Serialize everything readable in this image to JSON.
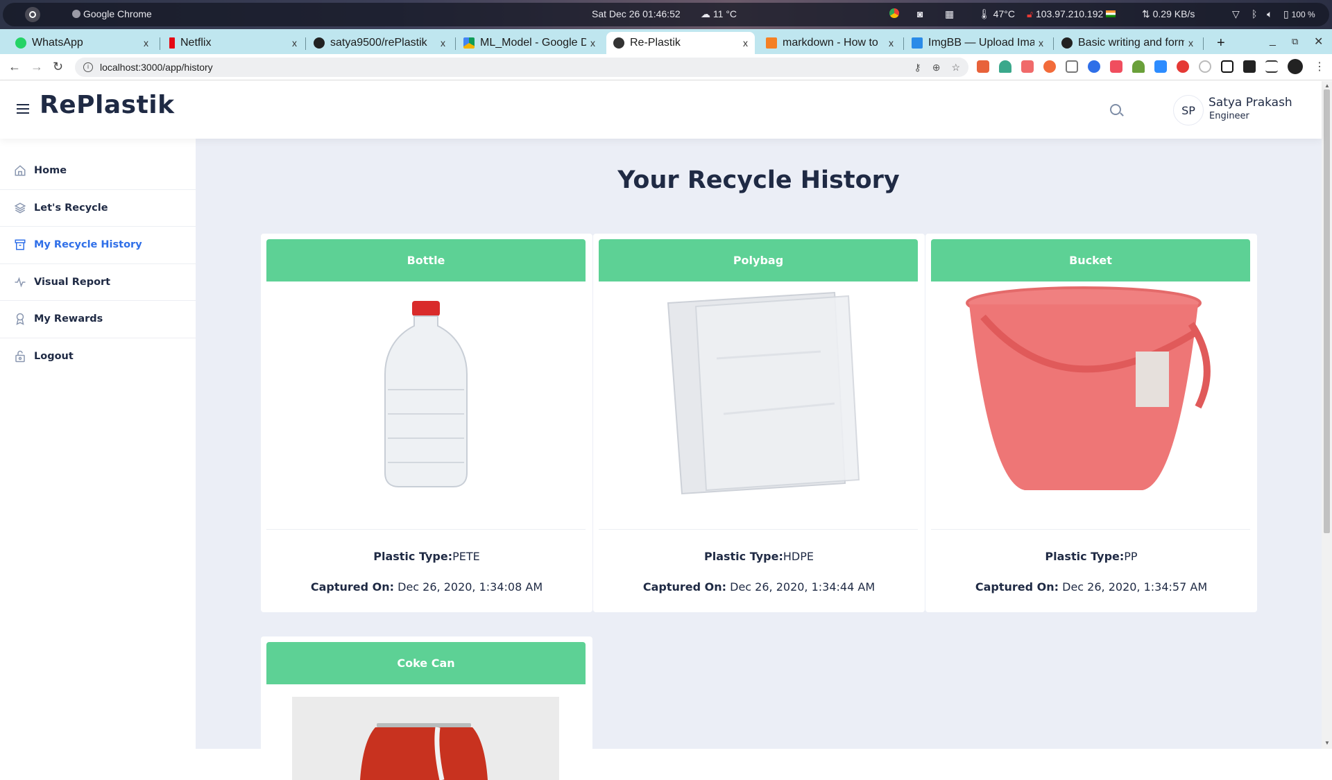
{
  "os_bar": {
    "app_name": "Google Chrome",
    "datetime": "Sat Dec 26  01:46:52",
    "weather": "11 °C",
    "cpu_temp": "47°C",
    "ip": "103.97.210.192",
    "net_speed": "0.29 KB/s",
    "battery": "100 %"
  },
  "tabs": [
    {
      "title": "WhatsApp",
      "icon": "whatsapp-icon",
      "color": "#25d366",
      "active": false
    },
    {
      "title": "Netflix",
      "icon": "netflix-icon",
      "color": "#e50914",
      "active": false
    },
    {
      "title": "satya9500/rePlastik",
      "icon": "github-icon",
      "color": "#222222",
      "active": false
    },
    {
      "title": "ML_Model - Google Drive",
      "icon": "google-drive-icon",
      "color": "#f4b400",
      "active": false
    },
    {
      "title": "Re-Plastik",
      "icon": "angular-icon",
      "color": "#333333",
      "active": true
    },
    {
      "title": "markdown - How to",
      "icon": "stackoverflow-icon",
      "color": "#f48024",
      "active": false
    },
    {
      "title": "ImgBB — Upload Image",
      "icon": "imgbb-icon",
      "color": "#2a8be8",
      "active": false
    },
    {
      "title": "Basic writing and formatting",
      "icon": "github-icon",
      "color": "#222222",
      "active": false
    }
  ],
  "tab_close_glyph": "x",
  "new_tab_glyph": "+",
  "address": {
    "url": "localhost:3000/app/history"
  },
  "app": {
    "brand": "RePlastik",
    "user": {
      "initials": "SP",
      "name": "Satya Prakash",
      "role": "Engineer"
    }
  },
  "sidebar": {
    "items": [
      {
        "label": "Home",
        "icon": "home-icon",
        "active": false
      },
      {
        "label": "Let's Recycle",
        "icon": "layers-icon",
        "active": false
      },
      {
        "label": "My Recycle History",
        "icon": "archive-icon",
        "active": true
      },
      {
        "label": "Visual Report",
        "icon": "activity-icon",
        "active": false
      },
      {
        "label": "My Rewards",
        "icon": "award-icon",
        "active": false
      },
      {
        "label": "Logout",
        "icon": "lock-icon",
        "active": false
      }
    ]
  },
  "main": {
    "title": "Your Recycle History",
    "type_label": "Plastic Type:",
    "date_label": "Captured On:",
    "accent_color": "#5dd195",
    "cards": [
      {
        "name": "Bottle",
        "plastic_type": "PETE",
        "captured_on": " Dec 26, 2020, 1:34:08 AM",
        "image": "plastic-bottle"
      },
      {
        "name": "Polybag",
        "plastic_type": "HDPE",
        "captured_on": " Dec 26, 2020, 1:34:44 AM",
        "image": "polybag"
      },
      {
        "name": "Bucket",
        "plastic_type": "PP",
        "captured_on": " Dec 26, 2020, 1:34:57 AM",
        "image": "red-bucket"
      },
      {
        "name": "Coke Can",
        "plastic_type": "",
        "captured_on": "",
        "image": "coke-can"
      }
    ]
  }
}
